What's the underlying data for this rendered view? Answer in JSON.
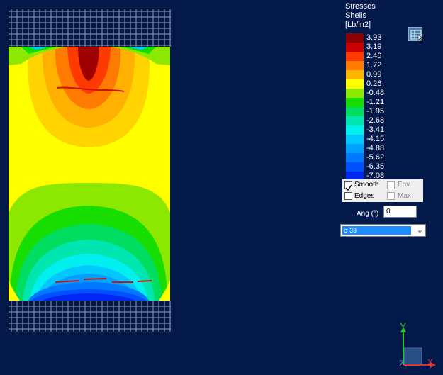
{
  "legend": {
    "title_lines": [
      "Stresses",
      "Shells",
      "[Lb/in2]"
    ],
    "items": [
      {
        "value": "3.93",
        "color": "#8b0000"
      },
      {
        "value": "3.19",
        "color": "#c80000"
      },
      {
        "value": "2.46",
        "color": "#ff3a00"
      },
      {
        "value": "1.72",
        "color": "#ff7a00"
      },
      {
        "value": "0.99",
        "color": "#ffb400"
      },
      {
        "value": "0.26",
        "color": "#ffff00"
      },
      {
        "value": "-0.48",
        "color": "#8ce800"
      },
      {
        "value": "-1.21",
        "color": "#18dd00"
      },
      {
        "value": "-1.95",
        "color": "#00dd60"
      },
      {
        "value": "-2.68",
        "color": "#00e6b0"
      },
      {
        "value": "-3.41",
        "color": "#00f0f0"
      },
      {
        "value": "-4.15",
        "color": "#00c8ff"
      },
      {
        "value": "-4.88",
        "color": "#00a0ff"
      },
      {
        "value": "-5.62",
        "color": "#0078ff"
      },
      {
        "value": "-6.35",
        "color": "#0050ff"
      },
      {
        "value": "-7.08",
        "color": "#0028f0"
      }
    ]
  },
  "options": {
    "smooth_label": "Smooth",
    "smooth_checked": true,
    "edges_label": "Edges",
    "edges_checked": false,
    "env_label": "Env",
    "max_label": "Max"
  },
  "angle": {
    "label": "Ang (°)",
    "value": "0"
  },
  "component": {
    "selected": "σ 33"
  },
  "axes": {
    "y_label": "Y",
    "x_label": "X",
    "z_label": "Z",
    "y_color": "#27c52a",
    "x_color": "#e53030"
  }
}
